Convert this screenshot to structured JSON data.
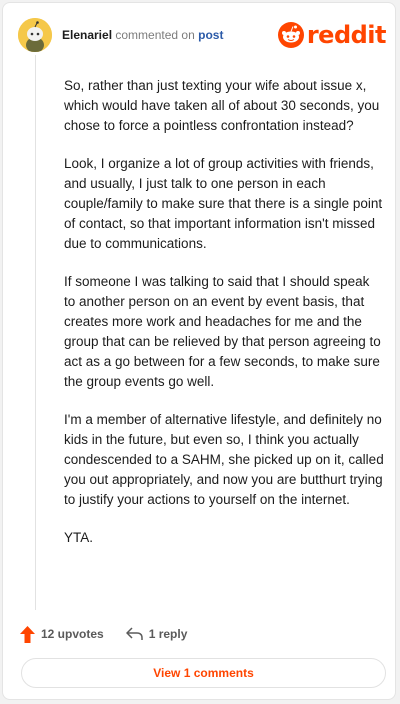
{
  "header": {
    "author": "Elenariel",
    "action_text": "commented on",
    "post_link": "post",
    "brand": "reddit"
  },
  "comment": {
    "paragraphs": [
      "So, rather than just texting your wife about issue x, which would have taken all of about 30 seconds, you chose to force a pointless confrontation instead?",
      "Look, I organize a lot of group activities with friends, and usually, I just talk to one person in each couple/family to make sure that there is a single point of contact, so that important information isn't missed due to communications.",
      "If someone I was talking to said that I should speak to another person on an event by event basis, that creates more work and headaches for me and the group that can be relieved by that person agreeing to act as a go between for a few seconds, to make sure the group events go well.",
      "I'm a member of alternative lifestyle, and definitely no kids in the future, but even so, I think you actually condescended to a SAHM, she picked up on it, called you out appropriately, and now you are butthurt trying to justify your actions to yourself on the internet.",
      "YTA."
    ]
  },
  "actions": {
    "upvotes": "12 upvotes",
    "replies": "1 reply"
  },
  "footer": {
    "view_comments": "View 1 comments"
  },
  "colors": {
    "brand": "#ff4500",
    "link": "#2b5aa8",
    "avatar": "#f5c84a"
  }
}
